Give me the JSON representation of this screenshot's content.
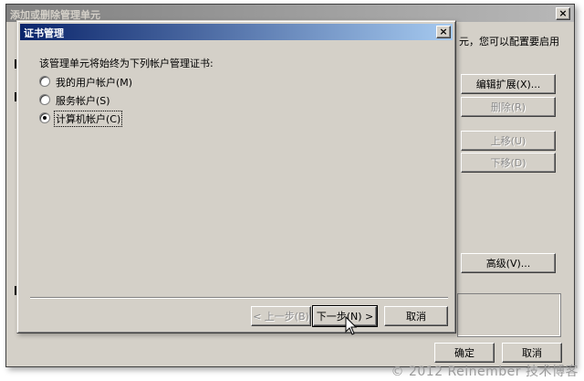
{
  "background_dialog": {
    "title": "添加或删除管理单元",
    "desc_snippet": "元，您可以配置要启用",
    "edit_ext_label": "编辑扩展(X)...",
    "remove_label": "删除(R)",
    "move_up_label": "上移(U)",
    "move_down_label": "下移(D)",
    "advanced_label": "高级(V)...",
    "ok_label": "确定",
    "cancel_label": "取消",
    "close_glyph": "×"
  },
  "dialog": {
    "title": "证书管理",
    "close_glyph": "×",
    "prompt": "该管理单元将始终为下列帐户管理证书:",
    "options": [
      {
        "label": "我的用户帐户(M)",
        "selected": false
      },
      {
        "label": "服务帐户(S)",
        "selected": false
      },
      {
        "label": "计算机帐户(C)",
        "selected": true
      }
    ],
    "back_label": "< 上一步(B)",
    "next_label": "下一步(N) >",
    "cancel_label": "取消"
  },
  "watermark": "© 2012 Reinember 技术博客"
}
